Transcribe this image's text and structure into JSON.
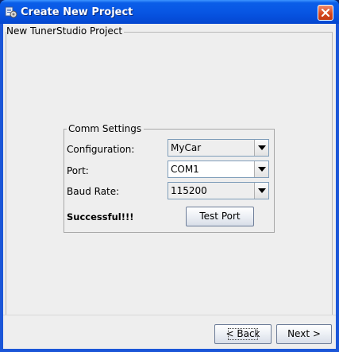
{
  "window": {
    "title": "Create New Project",
    "icon": "app-icon",
    "close_icon": "close-icon"
  },
  "project_group": {
    "title": "New TunerStudio Project"
  },
  "comm_settings": {
    "title": "Comm Settings",
    "configuration": {
      "label": "Configuration:",
      "value": "MyCar"
    },
    "port": {
      "label": "Port:",
      "value": "COM1"
    },
    "baud_rate": {
      "label": "Baud Rate:",
      "value": "115200"
    },
    "status": "Successful!!!",
    "test_port_label": "Test Port"
  },
  "nav": {
    "back_label": "< Back",
    "next_label": "Next >"
  }
}
